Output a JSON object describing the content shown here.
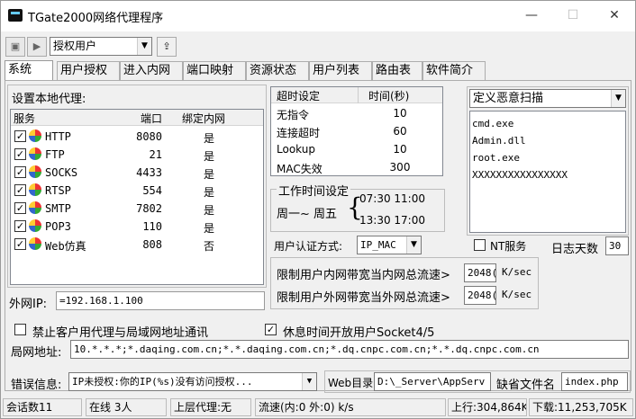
{
  "window": {
    "title": "TGate2000网络代理程序",
    "min": "—",
    "max": "☐",
    "close": "✕"
  },
  "toolbar": {
    "combo": "授权用户"
  },
  "tabs": [
    "系统",
    "用户授权",
    "进入内网",
    "端口映射",
    "资源状态",
    "用户列表",
    "路由表",
    "软件简介"
  ],
  "proxy": {
    "group_label": "设置本地代理:",
    "columns": [
      "服务",
      "端口",
      "绑定内网"
    ],
    "rows": [
      {
        "name": "HTTP",
        "port": "8080",
        "bind": "是",
        "checked": true
      },
      {
        "name": "FTP",
        "port": "21",
        "bind": "是",
        "checked": true
      },
      {
        "name": "SOCKS",
        "port": "4433",
        "bind": "是",
        "checked": true
      },
      {
        "name": "RTSP",
        "port": "554",
        "bind": "是",
        "checked": true
      },
      {
        "name": "SMTP",
        "port": "7802",
        "bind": "是",
        "checked": true
      },
      {
        "name": "POP3",
        "port": "110",
        "bind": "是",
        "checked": true
      },
      {
        "name": "Web仿真",
        "port": "808",
        "bind": "否",
        "checked": true
      }
    ]
  },
  "external_ip": {
    "label": "外网IP:",
    "value": "=192.168.1.100"
  },
  "timeout": {
    "columns": [
      "超时设定",
      "时间(秒)"
    ],
    "rows": [
      {
        "name": "无指令",
        "value": "10"
      },
      {
        "name": "连接超时",
        "value": "60"
      },
      {
        "name": "Lookup",
        "value": "10"
      },
      {
        "name": "MAC失效",
        "value": "300"
      }
    ]
  },
  "worktime": {
    "label": "工作时间设定",
    "days": "周一~ 周五",
    "brace": "{",
    "t1": "07:30  11:00",
    "t2": "13:30  17:00"
  },
  "scan": {
    "combo": "定义恶意扫描",
    "items": [
      "cmd.exe",
      "Admin.dll",
      "root.exe",
      "XXXXXXXXXXXXXXXX"
    ]
  },
  "auth": {
    "label": "用户认证方式:",
    "value": "IP_MAC"
  },
  "nt": {
    "label": "NT服务",
    "checked": false
  },
  "logdays": {
    "label": "日志天数",
    "value": "30"
  },
  "bandwidth": {
    "in_label": "限制用户内网带宽当内网总流速>",
    "in_value": "2048(",
    "in_unit": "K/sec",
    "out_label": "限制用户外网带宽当外网总流速>",
    "out_value": "2048(",
    "out_unit": "K/sec"
  },
  "options": {
    "block_label": "禁止客户用代理与局域网地址通讯",
    "block_checked": false,
    "socket_label": "休息时间开放用户Socket4/5",
    "socket_checked": true
  },
  "lan": {
    "label": "局网地址:",
    "value": "10.*.*.*;*.daqing.com.cn;*.*.daqing.com.cn;*.dq.cnpc.com.cn;*.*.dq.cnpc.com.cn"
  },
  "error": {
    "label": "错误信息:",
    "value": "IP未授权:你的IP(%s)没有访问授权..."
  },
  "web": {
    "dir_label": "Web目录",
    "dir_value": "D:\\_Server\\AppServ",
    "missing_label": "缺省文件名",
    "missing_value": "index.php"
  },
  "status": {
    "sessions": "会话数11",
    "online": "在线 3人",
    "upper": "上层代理:无",
    "flow": "流速(内:0 外:0) k/s",
    "up": "上行:304,864K",
    "down": "下载:11,253,705K"
  }
}
